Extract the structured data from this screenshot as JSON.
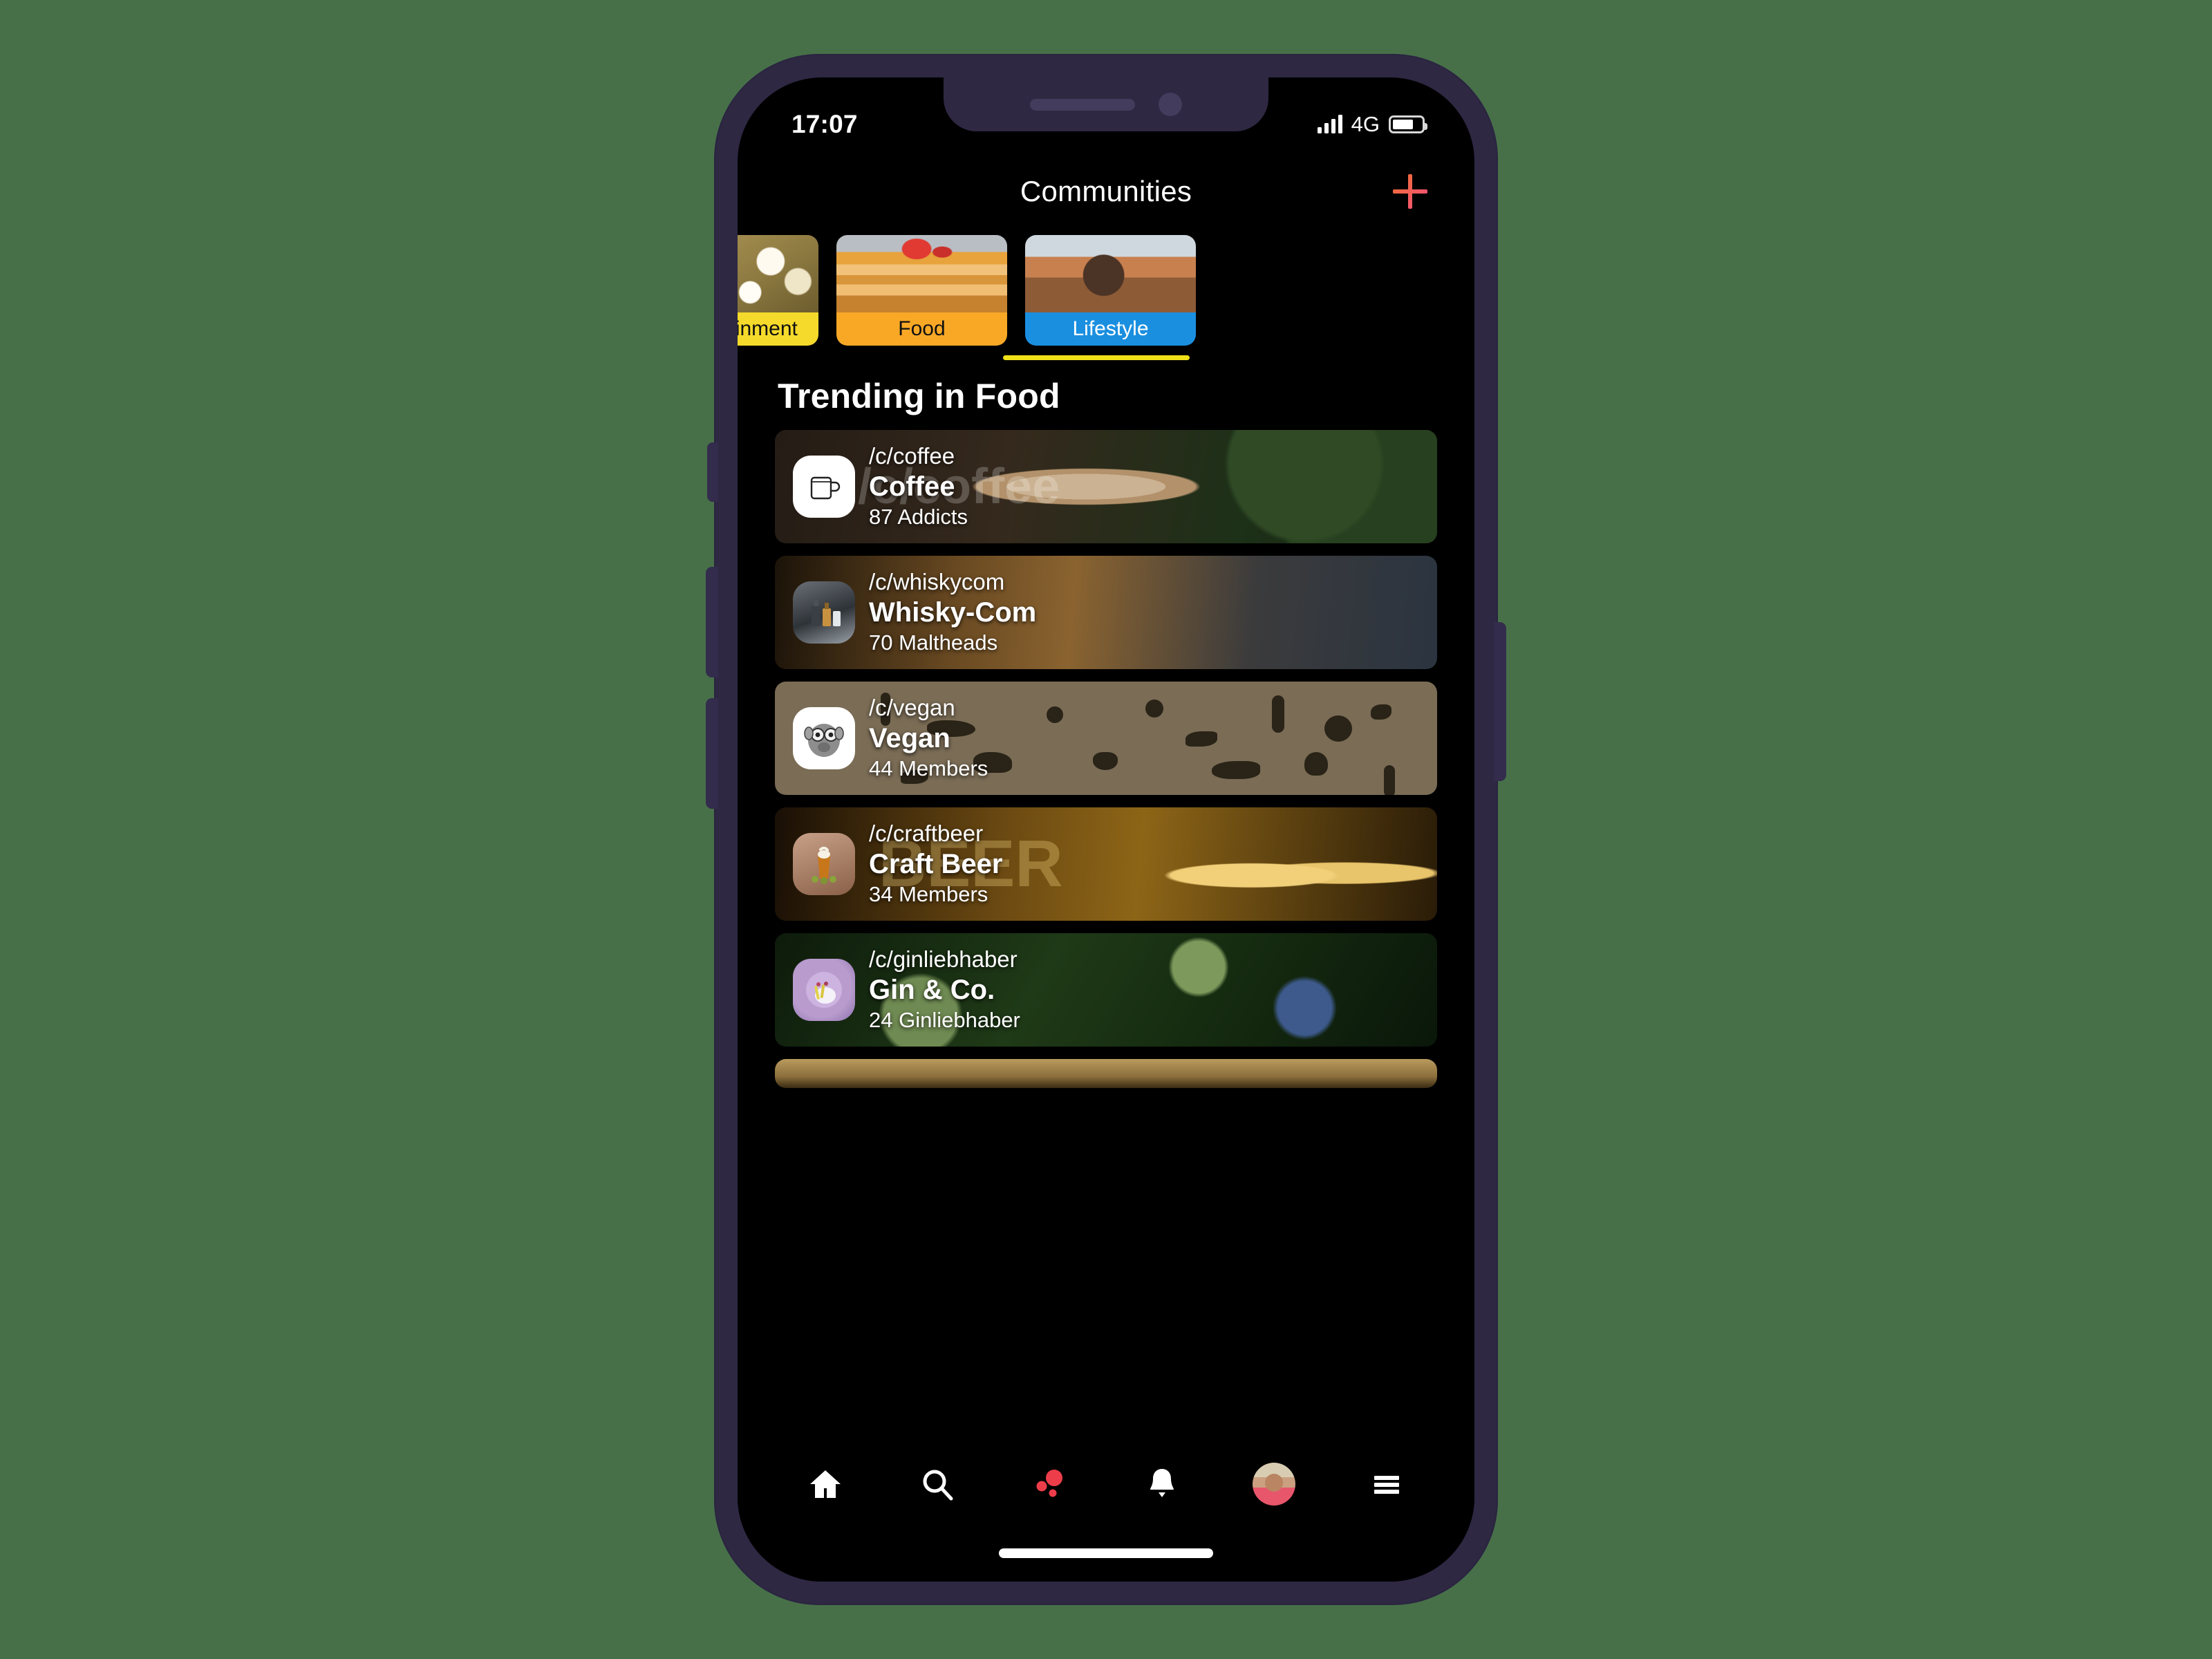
{
  "theme": {
    "page_background": "#477049",
    "phone_frame": "#2e2843",
    "screen_background": "#000000",
    "accent_plus": "#f4566e",
    "active_tab_underline": "#f0e118",
    "active_nav": "#ee3d4a"
  },
  "status_bar": {
    "time": "17:07",
    "network": "4G",
    "signal_icon": "signal-bars-icon",
    "battery_icon": "battery-icon",
    "battery_level_percent": 72
  },
  "header": {
    "title": "Communities",
    "add_button_icon": "plus-icon",
    "add_button_label": "+"
  },
  "categories": [
    {
      "label": "Entertainment",
      "bg_color": "#f5da2b",
      "text_color": "#111111",
      "image": "popcorn-photo",
      "active": false,
      "partially_visible": true
    },
    {
      "label": "Food",
      "bg_color": "#f9a826",
      "text_color": "#111111",
      "image": "pancakes-photo",
      "active": true,
      "partially_visible": false
    },
    {
      "label": "Lifestyle",
      "bg_color": "#1a8fe0",
      "text_color": "#ffffff",
      "image": "headphones-person-photo",
      "active": false,
      "partially_visible": true
    }
  ],
  "section": {
    "heading": "Trending in Food"
  },
  "communities": [
    {
      "slug": "/c/coffee",
      "name": "Coffee",
      "members": "87 Addicts",
      "avatar_icon": "coffee-mug-icon",
      "watermark": "/c/coffee",
      "background": "latte-art-photo"
    },
    {
      "slug": "/c/whiskycom",
      "name": "Whisky-Com",
      "members": "70 Maltheads",
      "avatar_icon": "whisky-bottles-icon",
      "watermark": "",
      "background": "distillery-photo"
    },
    {
      "slug": "/c/vegan",
      "name": "Vegan",
      "members": "44 Members",
      "avatar_icon": "tarsier-icon",
      "watermark": "",
      "background": "animal-silhouettes-tan"
    },
    {
      "slug": "/c/craftbeer",
      "name": "Craft Beer",
      "members": "34 Members",
      "avatar_icon": "beer-glass-icon",
      "watermark": "BEER",
      "background": "beer-neon-photo"
    },
    {
      "slug": "/c/ginliebhaber",
      "name": "Gin & Co.",
      "members": "24 Ginliebhaber",
      "avatar_icon": "gin-glass-icon",
      "watermark": "",
      "background": "juniper-branches-photo"
    }
  ],
  "bottom_nav": [
    {
      "name": "home",
      "icon": "home-icon",
      "active": false
    },
    {
      "name": "search",
      "icon": "search-icon",
      "active": false
    },
    {
      "name": "communities",
      "icon": "dots-cluster-icon",
      "active": true
    },
    {
      "name": "notifications",
      "icon": "bell-icon",
      "active": false
    },
    {
      "name": "profile",
      "icon": "avatar-icon",
      "active": false
    },
    {
      "name": "menu",
      "icon": "hamburger-icon",
      "active": false
    }
  ]
}
